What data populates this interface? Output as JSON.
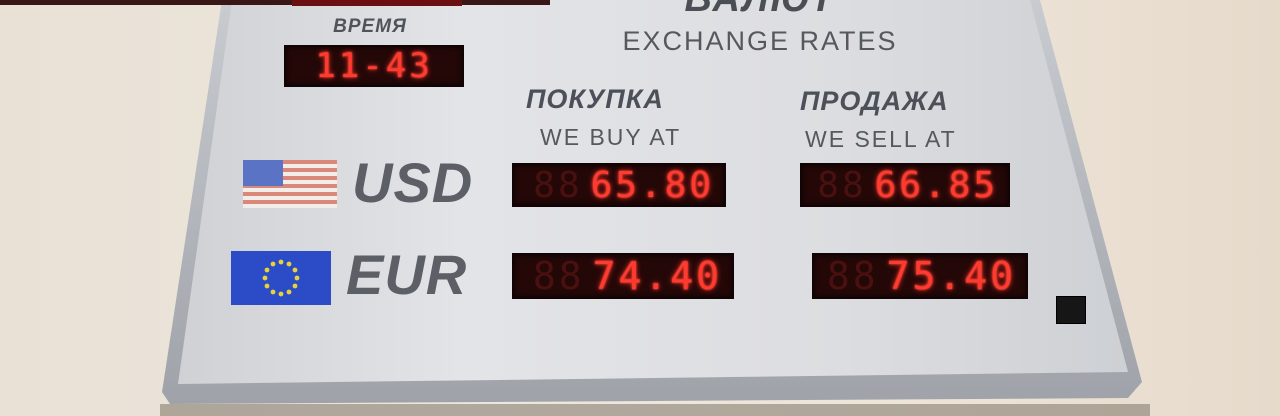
{
  "board": {
    "heading_ru": "ВАЛЮТ",
    "heading_en": "EXCHANGE RATES",
    "time_label": "ВРЕМЯ",
    "time_value": "11-43",
    "buy_label_ru": "ПОКУПКА",
    "buy_label_en": "WE BUY AT",
    "sell_label_ru": "ПРОДАЖА",
    "sell_label_en": "WE SELL AT"
  },
  "rates": [
    {
      "code": "USD",
      "flag": "us-flag-icon",
      "buy": "65.80",
      "sell": "66.85"
    },
    {
      "code": "EUR",
      "flag": "eu-flag-icon",
      "buy": "74.40",
      "sell": "75.40"
    }
  ],
  "colors": {
    "led_on": "#ff3a2e",
    "led_background": "#240808",
    "board_face": "#dedfe2",
    "frame": "#b9bcc1"
  }
}
